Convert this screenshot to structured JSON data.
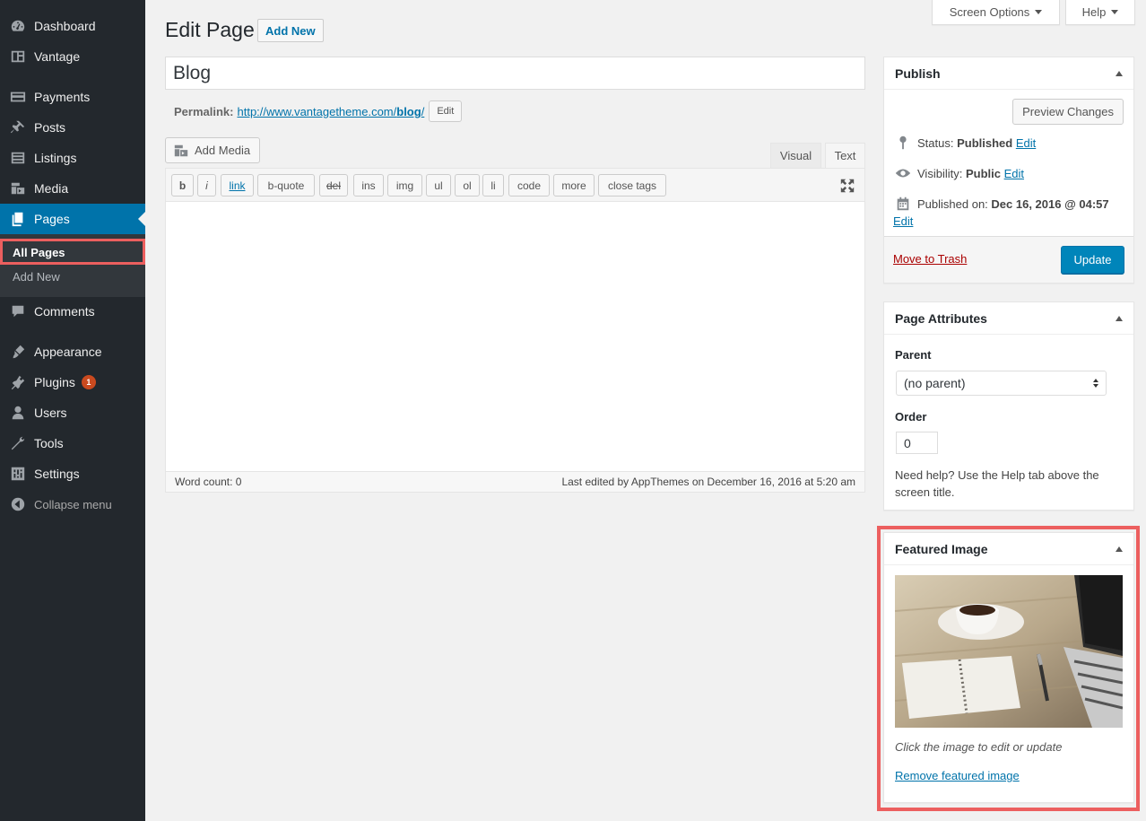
{
  "sidebar": {
    "items": [
      {
        "label": "Dashboard",
        "icon": "dashboard-icon"
      },
      {
        "label": "Vantage",
        "icon": "vantage-icon"
      },
      {
        "label": "Payments",
        "icon": "payments-icon"
      },
      {
        "label": "Posts",
        "icon": "pin-icon"
      },
      {
        "label": "Listings",
        "icon": "listings-icon"
      },
      {
        "label": "Media",
        "icon": "media-icon"
      },
      {
        "label": "Pages",
        "icon": "pages-icon"
      },
      {
        "label": "Comments",
        "icon": "comments-icon"
      },
      {
        "label": "Appearance",
        "icon": "appearance-icon"
      },
      {
        "label": "Plugins",
        "icon": "plugins-icon",
        "badge": "1"
      },
      {
        "label": "Users",
        "icon": "users-icon"
      },
      {
        "label": "Tools",
        "icon": "tools-icon"
      },
      {
        "label": "Settings",
        "icon": "settings-icon"
      },
      {
        "label": "Collapse menu",
        "icon": "collapse-icon"
      }
    ],
    "submenu": [
      {
        "label": "All Pages"
      },
      {
        "label": "Add New"
      }
    ]
  },
  "topbar": {
    "screen_options": "Screen Options",
    "help": "Help"
  },
  "header": {
    "title": "Edit Page",
    "add_new": "Add New"
  },
  "post": {
    "title": "Blog",
    "permalink_label": "Permalink:",
    "permalink_url_base": "http://www.vantagetheme.com/",
    "permalink_slug": "blog",
    "permalink_trailing": "/",
    "permalink_edit": "Edit"
  },
  "editor": {
    "add_media": "Add Media",
    "tab_visual": "Visual",
    "tab_text": "Text",
    "quicktags": [
      "b",
      "i",
      "link",
      "b-quote",
      "del",
      "ins",
      "img",
      "ul",
      "ol",
      "li",
      "code",
      "more",
      "close tags"
    ],
    "word_count": "Word count: 0",
    "last_edited": "Last edited by AppThemes on December 16, 2016 at 5:20 am"
  },
  "publish": {
    "title": "Publish",
    "preview": "Preview Changes",
    "status_label": "Status:",
    "status_value": "Published",
    "visibility_label": "Visibility:",
    "visibility_value": "Public",
    "published_label": "Published on:",
    "published_value": "Dec 16, 2016 @ 04:57",
    "edit": "Edit",
    "trash": "Move to Trash",
    "update": "Update"
  },
  "page_attributes": {
    "title": "Page Attributes",
    "parent_label": "Parent",
    "parent_value": "(no parent)",
    "order_label": "Order",
    "order_value": "0",
    "help": "Need help? Use the Help tab above the screen title."
  },
  "featured_image": {
    "title": "Featured Image",
    "caption": "Click the image to edit or update",
    "remove": "Remove featured image"
  },
  "colors": {
    "sidebar_bg": "#23282d",
    "active": "#0073aa",
    "highlight": "#ec5f5f",
    "primary_button": "#0085ba"
  }
}
